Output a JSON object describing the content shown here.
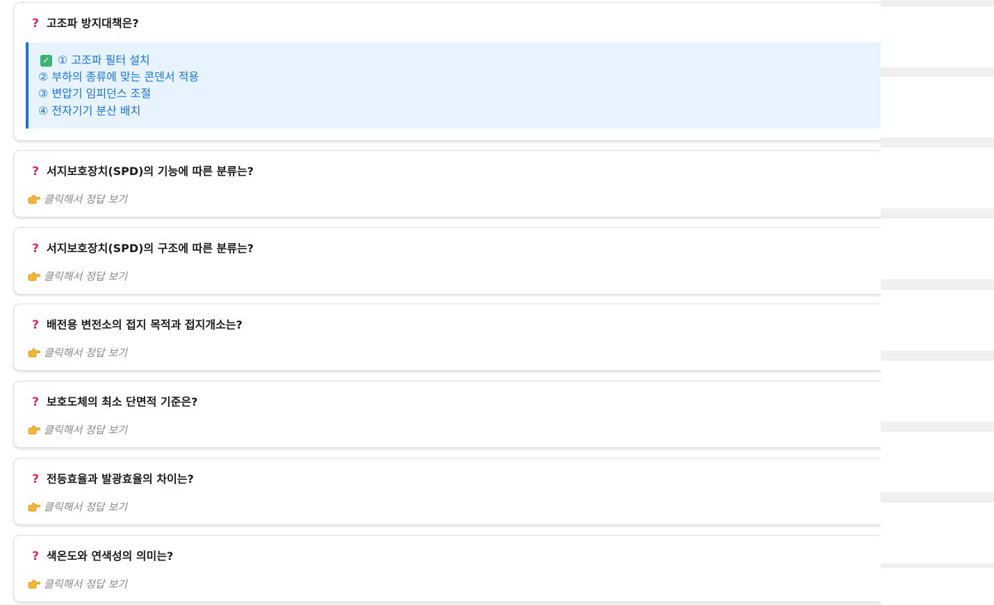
{
  "cards": [
    {
      "question": "고조파 방지대책은?",
      "answer_lines": [
        "① 고조파 필터 설치",
        "② 부하의 종류에 맞는 콘덴서 적용",
        "③ 변압기 임피던스 조절",
        "④ 전자기기 분산 배치"
      ]
    },
    {
      "question": "서지보호장치(SPD)의 기능에 따른 분류는?",
      "reveal_label": "클릭해서 정답 보기"
    },
    {
      "question": "서지보호장치(SPD)의 구조에 따른 분류는?",
      "reveal_label": "클릭해서 정답 보기"
    },
    {
      "question": "배전용 변전소의 접지 목적과 접지개소는?",
      "reveal_label": "클릭해서 정답 보기"
    },
    {
      "question": "보호도체의 최소 단면적 기준은?",
      "reveal_label": "클릭해서 정답 보기"
    },
    {
      "question": "전등효율과 발광효율의 차이는?",
      "reveal_label": "클릭해서 정답 보기"
    },
    {
      "question": "색온도와 연색성의 의미는?",
      "reveal_label": "클릭해서 정답 보기"
    }
  ],
  "icons": {
    "question": "question-mark-icon",
    "reveal": "pointing-hand-icon",
    "answer_check": "check-mark-icon"
  },
  "colors": {
    "question_mark": "#e0245e",
    "answer_text": "#1a73d9",
    "answer_bg": "#e7f3ff",
    "reveal_text": "#888888"
  }
}
